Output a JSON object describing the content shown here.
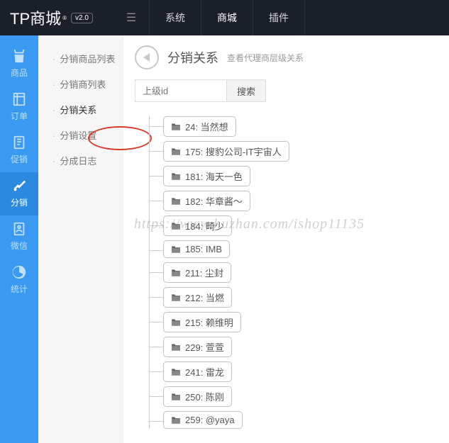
{
  "header": {
    "logo_text": "TP商城",
    "logo_reg": "®",
    "version": "v2.0",
    "nav": [
      "系统",
      "商城",
      "插件"
    ],
    "nav_active": 1
  },
  "iconbar": [
    {
      "label": "商品"
    },
    {
      "label": "订单"
    },
    {
      "label": "促销"
    },
    {
      "label": "分销"
    },
    {
      "label": "微信"
    },
    {
      "label": "统计"
    }
  ],
  "iconbar_active": 3,
  "subnav": {
    "items": [
      "分销商品列表",
      "分销商列表",
      "分销关系",
      "分销设置",
      "分成日志"
    ],
    "active": 2
  },
  "page": {
    "title": "分销关系",
    "subtitle": "查看代理商层级关系"
  },
  "search": {
    "placeholder": "上级id",
    "button": "搜索"
  },
  "tree": [
    "24: 当然想",
    "175: 搜豹公司-IT宇宙人",
    "181: 海天一色",
    "182: 华章酱～",
    "184: 畸少",
    "185: IMB",
    "211: 尘封",
    "212: 当燃",
    "215: 赖维明",
    "229: 萱萱",
    "241: 雷龙",
    "250: 陈刚",
    "259: @yaya"
  ],
  "watermark": "https://www.huzhan.com/ishop11135"
}
